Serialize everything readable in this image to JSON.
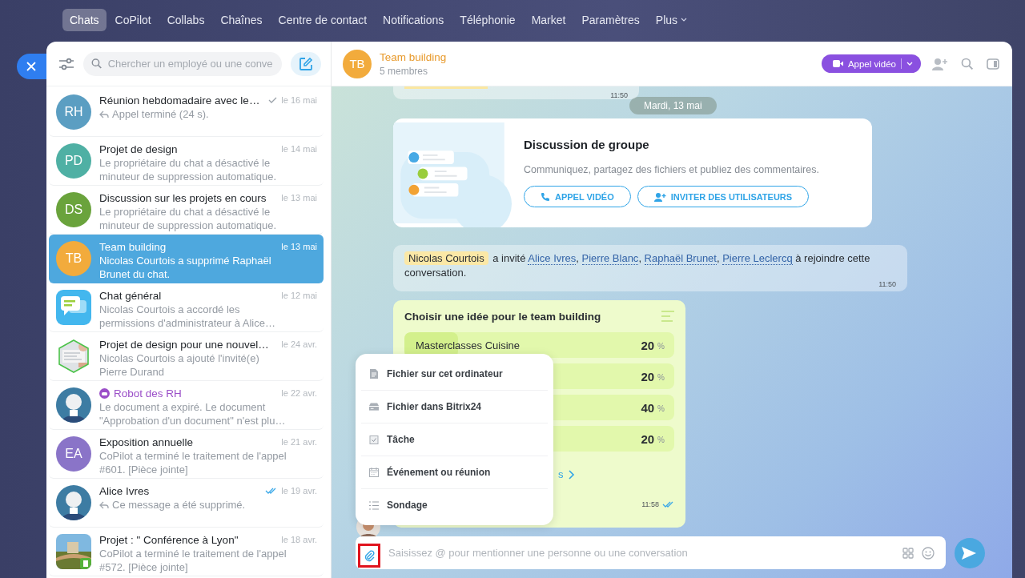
{
  "nav": {
    "items": [
      {
        "label": "Chats",
        "selected": true
      },
      {
        "label": "CoPilot",
        "selected": false
      },
      {
        "label": "Collabs",
        "selected": false
      },
      {
        "label": "Chaînes",
        "selected": false
      },
      {
        "label": "Centre de contact",
        "selected": false
      },
      {
        "label": "Notifications",
        "selected": false
      },
      {
        "label": "Téléphonie",
        "selected": false
      },
      {
        "label": "Market",
        "selected": false
      },
      {
        "label": "Paramètres",
        "selected": false
      }
    ],
    "more": "Plus"
  },
  "sidebar": {
    "search_placeholder": "Chercher un employé ou une conve",
    "chats": [
      {
        "name": "Réunion hebdomadaire avec le…",
        "date": "le 16 mai",
        "preview": "Appel terminé (24 s).",
        "reply": true,
        "seen": false,
        "avatar": {
          "kind": "initials",
          "text": "RH",
          "color": "#5b9ec2"
        },
        "selected": false
      },
      {
        "name": "Projet de design",
        "date": "le 14 mai",
        "preview": "Le propriétaire du chat a désactivé le minuteur de suppression automatique.",
        "avatar": {
          "kind": "initials",
          "text": "PD",
          "color": "#4fb0a4"
        },
        "selected": false
      },
      {
        "name": "Discussion sur les projets en cours",
        "date": "le 13 mai",
        "preview": "Le propriétaire du chat a désactivé le minuteur de suppression automatique.",
        "avatar": {
          "kind": "initials",
          "text": "DS",
          "color": "#6aa33c"
        },
        "selected": false
      },
      {
        "name": "Team building",
        "date": "le 13 mai",
        "preview": "Nicolas Courtois a supprimé Raphaël Brunet du chat.",
        "avatar": {
          "kind": "initials",
          "text": "TB",
          "color": "#f2ab3c"
        },
        "selected": true
      },
      {
        "name": "Chat général",
        "date": "le 12 mai",
        "preview": "Nicolas Courtois a accordé les permissions d'administrateur à Alice…",
        "avatar": {
          "kind": "app"
        },
        "selected": false
      },
      {
        "name": "Projet de design pour une nouvel…",
        "date": "le 24 avr.",
        "preview": "Nicolas Courtois a ajouté l'invité(e) Pierre Durand",
        "avatar": {
          "kind": "hexagon"
        },
        "selected": false
      },
      {
        "name": "Robot des RH",
        "date": "le 22 avr.",
        "preview": "Le document a expiré. Le document \"Approbation d'un document\" n'est plu…",
        "bot": true,
        "selected": false
      },
      {
        "name": "Exposition annuelle",
        "date": "le 21 avr.",
        "preview": "CoPilot a terminé le traitement de l'appel #601. [Pièce jointe]",
        "avatar": {
          "kind": "initials",
          "text": "EA",
          "color": "#8a74c8"
        },
        "selected": false
      },
      {
        "name": "Alice Ivres",
        "date": "le 19 avr.",
        "preview": "Ce message a été supprimé.",
        "reply": true,
        "seen": true,
        "selected": false
      },
      {
        "name": "Projet : \" Conférence à Lyon\"",
        "date": "le 18 avr.",
        "preview": "CoPilot a terminé le traitement de l'appel #572. [Pièce jointe]",
        "avatar": {
          "kind": "square"
        },
        "selected": false
      }
    ]
  },
  "chat": {
    "avatar": "TB",
    "title": "Team building",
    "subtitle": "5 membres",
    "call_button": "Appel vidéo",
    "top_time": "11:50",
    "date": "Mardi, 13 mai",
    "card": {
      "title": "Discussion de groupe",
      "text": "Communiquez, partagez des fichiers et publiez des commentaires.",
      "buttons": [
        {
          "kind": "call",
          "label": "APPEL VIDÉO"
        },
        {
          "kind": "invite",
          "label": "INVITER DES UTILISATEURS"
        }
      ]
    },
    "system": {
      "parts": [
        {
          "kind": "mention",
          "text": "Nicolas Courtois"
        },
        {
          "kind": "text",
          "text": " a invité "
        },
        {
          "kind": "link",
          "text": "Alice Ivres"
        },
        {
          "kind": "text",
          "text": ", "
        },
        {
          "kind": "link",
          "text": "Pierre Blanc"
        },
        {
          "kind": "text",
          "text": ", "
        },
        {
          "kind": "link",
          "text": "Raphaël Brunet"
        },
        {
          "kind": "text",
          "text": ", "
        },
        {
          "kind": "link",
          "text": "Pierre Leclercq"
        },
        {
          "kind": "text",
          "text": " à rejoindre cette conversation."
        }
      ],
      "time": "11:50"
    },
    "poll": {
      "title": "Choisir une idée pour le team building",
      "options": [
        {
          "label": "Masterclasses Cuisine",
          "percent": "20",
          "level": 0.2
        },
        {
          "percent": "20"
        },
        {
          "percent": "40"
        },
        {
          "percent": "20"
        }
      ],
      "unit": "%",
      "link": "s",
      "time": "11:58"
    },
    "menu": [
      {
        "kind": "file",
        "label": "Fichier sur cet ordinateur"
      },
      {
        "kind": "disk",
        "label": "Fichier dans Bitrix24"
      },
      {
        "kind": "task",
        "label": "Tâche"
      },
      {
        "kind": "event",
        "label": "Événement ou réunion"
      },
      {
        "kind": "poll",
        "label": "Sondage"
      }
    ],
    "input_placeholder": "Saisissez @ pour mentionner une personne ou une conversation"
  }
}
